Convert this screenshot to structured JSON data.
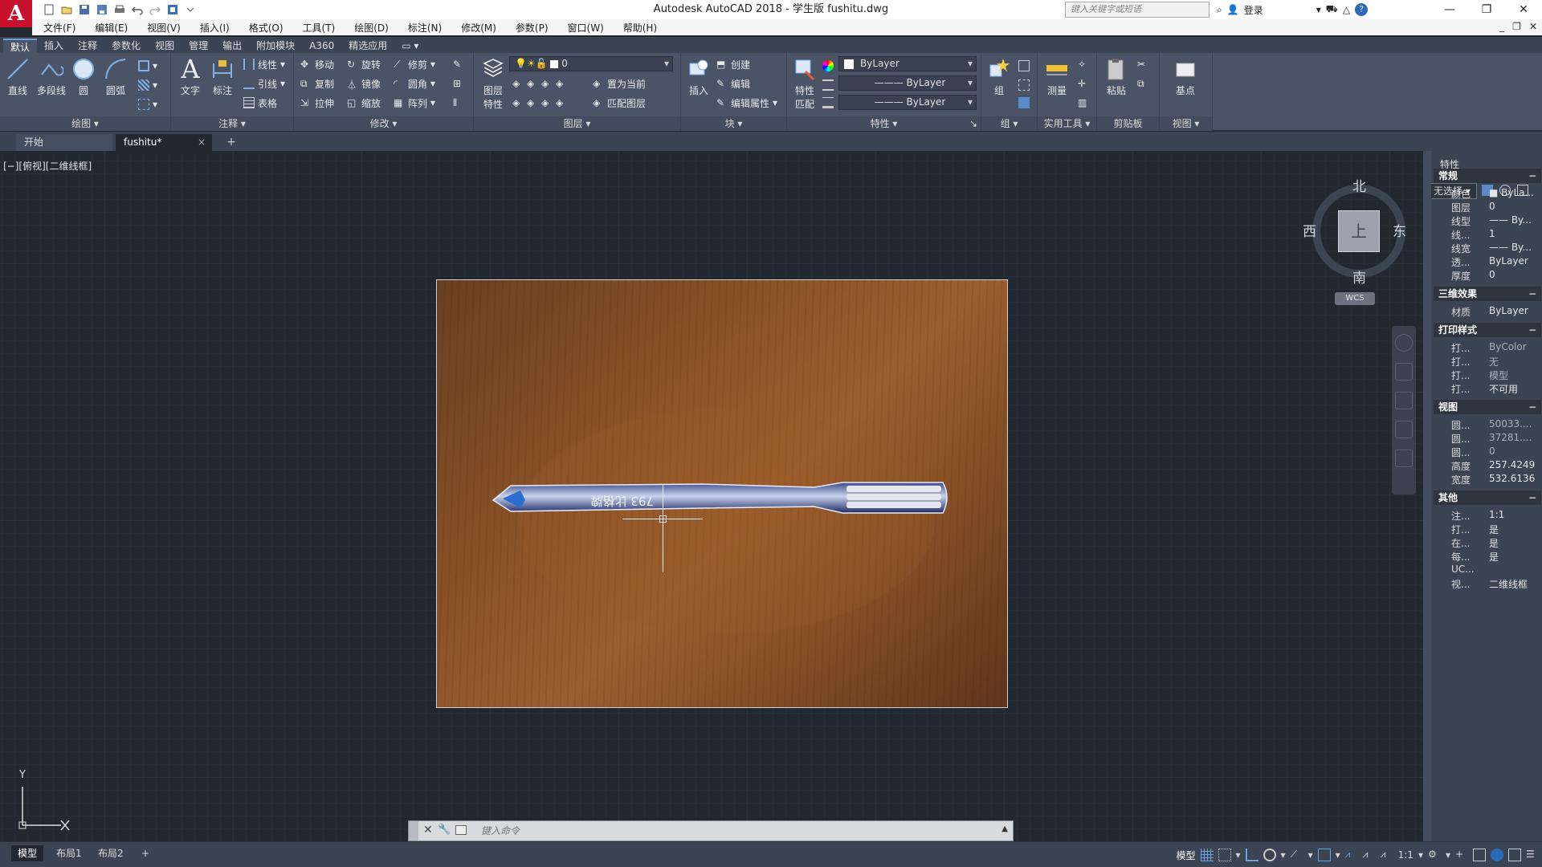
{
  "titlebar": {
    "title": "Autodesk AutoCAD 2018 - 学生版    fushitu.dwg",
    "search_placeholder": "键入关键字或短语",
    "login": "登录",
    "app_logo": "A"
  },
  "menubar": {
    "items": [
      "文件(F)",
      "编辑(E)",
      "视图(V)",
      "插入(I)",
      "格式(O)",
      "工具(T)",
      "绘图(D)",
      "标注(N)",
      "修改(M)",
      "参数(P)",
      "窗口(W)",
      "帮助(H)"
    ]
  },
  "ribbon_tabs": [
    "默认",
    "插入",
    "注释",
    "参数化",
    "视图",
    "管理",
    "输出",
    "附加模块",
    "A360",
    "精选应用"
  ],
  "ribbon": {
    "draw": {
      "label": "绘图",
      "line": "直线",
      "polyline": "多段线",
      "circle": "圆",
      "arc": "圆弧"
    },
    "annotate": {
      "label": "注释",
      "text": "文字",
      "dimension": "标注",
      "linear": "线性",
      "leader": "引线",
      "table": "表格"
    },
    "modify": {
      "label": "修改",
      "move": "移动",
      "rotate": "旋转",
      "trim": "修剪",
      "copy": "复制",
      "mirror": "镜像",
      "fillet": "圆角",
      "stretch": "拉伸",
      "scale": "缩放",
      "array": "阵列"
    },
    "layers": {
      "label": "图层",
      "layer_props": "图层特性",
      "layer_value": "0",
      "make_current": "置为当前",
      "match_layer": "匹配图层"
    },
    "block": {
      "label": "块",
      "insert": "插入",
      "create": "创建",
      "edit": "编辑",
      "edit_attr": "编辑属性"
    },
    "properties": {
      "label": "特性",
      "match": "特性匹配",
      "color": "ByLayer",
      "linetype": "ByLayer",
      "lineweight": "ByLayer"
    },
    "groups": {
      "label": "组",
      "group": "组"
    },
    "utilities": {
      "label": "实用工具",
      "measure": "测量"
    },
    "clipboard": {
      "label": "剪贴板",
      "paste": "粘贴"
    },
    "view": {
      "label": "视图",
      "base": "基点"
    }
  },
  "file_tabs": {
    "start": "开始",
    "doc": "fushitu*",
    "close": "×",
    "add": "+"
  },
  "drawing": {
    "viewport_label": "[−][俯视][二维线框]",
    "photo_annotation": "793  比格牌",
    "viewcube": {
      "north": "北",
      "south": "南",
      "east": "东",
      "west": "西",
      "face": "上",
      "wcs": "WCS"
    },
    "ucs_y": "Y"
  },
  "command_line": {
    "placeholder": "键入命令"
  },
  "layout_tabs": [
    "模型",
    "布局1",
    "布局2"
  ],
  "statusbar": {
    "model": "模型",
    "scale": "1:1"
  },
  "palette": {
    "title": "特性",
    "selection": "无选择",
    "sections": [
      {
        "name": "常规",
        "rows": [
          {
            "k": "颜色",
            "v": "■ ByLa..."
          },
          {
            "k": "图层",
            "v": "0"
          },
          {
            "k": "线型",
            "v": "—— By..."
          },
          {
            "k": "线...",
            "v": "1"
          },
          {
            "k": "线宽",
            "v": "—— By..."
          },
          {
            "k": "透...",
            "v": "ByLayer"
          },
          {
            "k": "厚度",
            "v": "0"
          }
        ]
      },
      {
        "name": "三维效果",
        "rows": [
          {
            "k": "材质",
            "v": "ByLayer"
          }
        ]
      },
      {
        "name": "打印样式",
        "rows": [
          {
            "k": "打...",
            "v": "ByColor"
          },
          {
            "k": "打...",
            "v": "无"
          },
          {
            "k": "打...",
            "v": "模型"
          },
          {
            "k": "打...",
            "v": "不可用"
          }
        ]
      },
      {
        "name": "视图",
        "rows": [
          {
            "k": "圆...",
            "v": "50033...."
          },
          {
            "k": "圆...",
            "v": "37281...."
          },
          {
            "k": "圆...",
            "v": "0"
          },
          {
            "k": "高度",
            "v": "257.4249"
          },
          {
            "k": "宽度",
            "v": "532.6136"
          }
        ]
      },
      {
        "name": "其他",
        "rows": [
          {
            "k": "注...",
            "v": "1:1"
          },
          {
            "k": "打...",
            "v": "是"
          },
          {
            "k": "在...",
            "v": "是"
          },
          {
            "k": "每...",
            "v": "是"
          },
          {
            "k": "UC...",
            "v": ""
          },
          {
            "k": "视...",
            "v": "二维线框"
          }
        ]
      }
    ]
  },
  "colors": {
    "accent": "#c8102e",
    "ribbon": "#4a5466",
    "canvas": "#212830"
  }
}
